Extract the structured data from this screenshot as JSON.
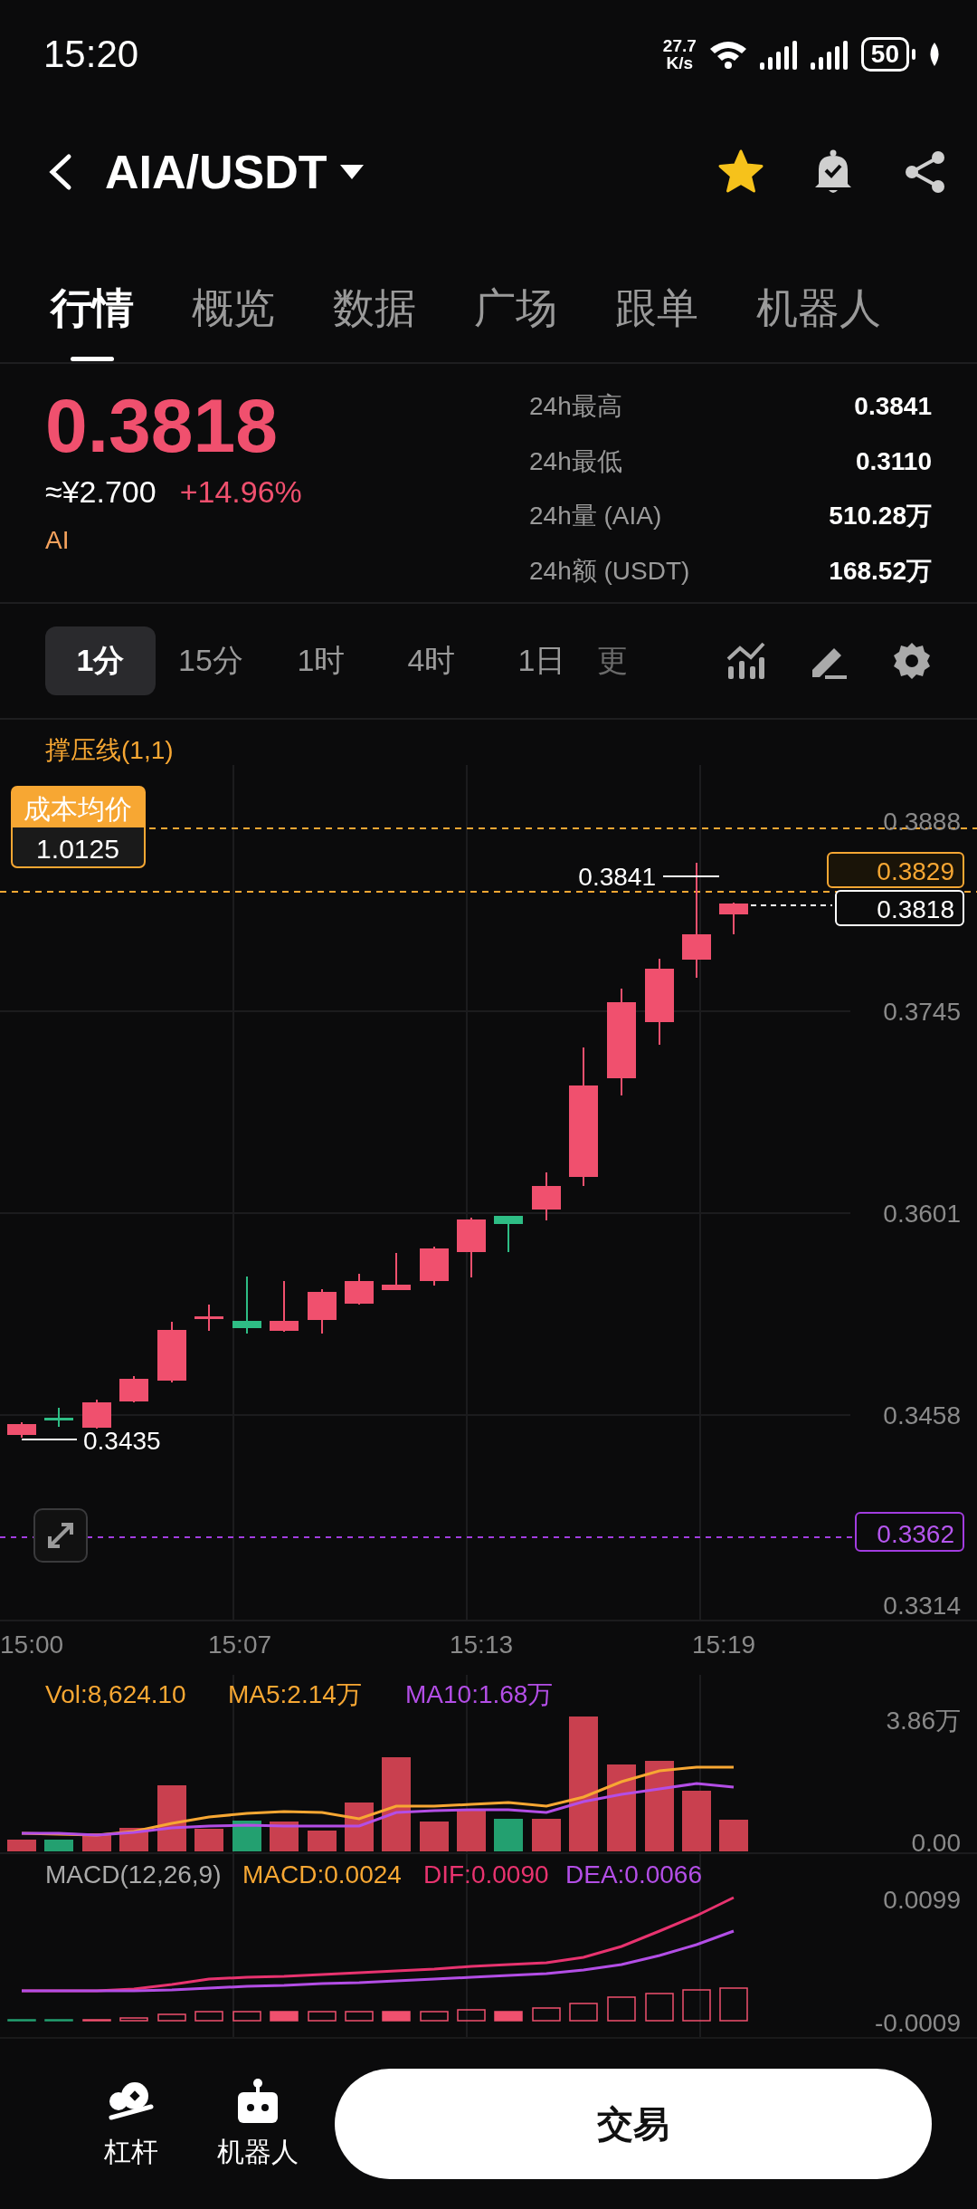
{
  "status_bar": {
    "time": "15:20",
    "net_speed_value": "27.7",
    "net_speed_unit": "K/s",
    "battery": "50"
  },
  "header": {
    "title": "AIA/USDT",
    "favorite": true
  },
  "tabs": [
    {
      "label": "行情",
      "selected": true
    },
    {
      "label": "概览",
      "selected": false
    },
    {
      "label": "数据",
      "selected": false
    },
    {
      "label": "广场",
      "selected": false
    },
    {
      "label": "跟单",
      "selected": false
    },
    {
      "label": "机器人",
      "selected": false
    }
  ],
  "ticker": {
    "price": "0.3818",
    "cny": "≈¥2.700",
    "change": "+14.96%",
    "tag": "AI",
    "stats": [
      {
        "label": "24h最高",
        "value": "0.3841"
      },
      {
        "label": "24h最低",
        "value": "0.3110"
      },
      {
        "label": "24h量 (AIA)",
        "value": "510.28万"
      },
      {
        "label": "24h额 (USDT)",
        "value": "168.52万"
      }
    ]
  },
  "intervals": [
    {
      "label": "1分",
      "selected": true
    },
    {
      "label": "15分",
      "selected": false
    },
    {
      "label": "1时",
      "selected": false
    },
    {
      "label": "4时",
      "selected": false
    },
    {
      "label": "1日",
      "selected": false
    },
    {
      "label": "更",
      "selected": false
    }
  ],
  "chart": {
    "indicator": "撑压线(1,1)",
    "cost_label": "成本均价",
    "cost_value": "1.0125",
    "price_ticks": [
      "0.3888",
      "0.3745",
      "0.3601",
      "0.3458",
      "0.3314"
    ],
    "time_ticks": [
      "15:00",
      "15:07",
      "15:13",
      "15:19"
    ],
    "high_label": "0.3841",
    "low_label": "0.3435",
    "resistance_label": "0.3829",
    "last_price_label": "0.3818",
    "support_label": "0.3362"
  },
  "volume": {
    "vol": "Vol:8,624.10",
    "ma5": "MA5:2.14万",
    "ma10": "MA10:1.68万",
    "ticks": [
      "3.86万",
      "0.00"
    ]
  },
  "macd": {
    "label": "MACD(12,26,9)",
    "macd": "MACD:0.0024",
    "dif": "DIF:0.0090",
    "dea": "DEA:0.0066",
    "ticks": [
      "0.0099",
      "-0.0009"
    ]
  },
  "bottom_bar": {
    "items": [
      {
        "label": "杠杆",
        "kind": "leverage"
      },
      {
        "label": "机器人",
        "kind": "robot"
      }
    ],
    "trade_button": "交易"
  }
}
